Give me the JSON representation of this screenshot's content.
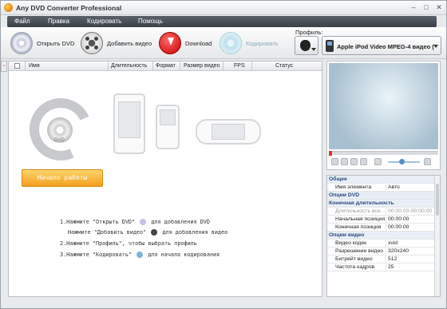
{
  "window": {
    "title": "Any DVD Converter Professional"
  },
  "menu": [
    {
      "label": "Файл"
    },
    {
      "label": "Правка"
    },
    {
      "label": "Кодировать"
    },
    {
      "label": "Помощь"
    }
  ],
  "toolbar": {
    "open_dvd": "Открыть DVD",
    "add_video": "Добавить видео",
    "download": "Download",
    "encode": "Кодировать"
  },
  "profile": {
    "label": "Профиль:",
    "value": "Apple iPod Video MPEG-4 видео (*.m..."
  },
  "table": {
    "columns": [
      "Имя",
      "Длительность",
      "Формат",
      "Размер видео",
      "FPS",
      "Статус"
    ]
  },
  "empty": {
    "dvd_text": "DVD",
    "start_button": "Начало работы",
    "hints": [
      "1.Нажмите \"Открыть DVD\"",
      "для добавления DVD",
      "Нажмите \"Добавить видео\"",
      "для добавления видео",
      "2.Нажмите \"Профиль\", чтобы выбрать профиль",
      "3.Нажмите \"Кодировать\"",
      "для начала кодирования"
    ]
  },
  "properties": {
    "general_header": "Общее",
    "item_name_key": "Имя элемента",
    "item_name_val": "Авто",
    "dvd_options_header": "Опции DVD",
    "end_duration_header": "Конечная длительность",
    "duration_all_key": "Длительность все...",
    "duration_all_val": "00:00:00-00:00:00",
    "start_pos_key": "Начальная позиция",
    "start_pos_val": "00:00:00",
    "end_pos_key": "Конечная позиция",
    "end_pos_val": "00:00:00",
    "video_options_header": "Опции видео",
    "codec_key": "Видео кодек",
    "codec_val": "xvid",
    "res_key": "Разрешение видео",
    "res_val": "320x240",
    "bitrate_key": "Битрейт видео",
    "bitrate_val": "512",
    "fps_key": "Частота кадров",
    "fps_val": "25"
  },
  "colors": {
    "accent": "#f2a01e",
    "menubar": "#4a5058",
    "group_header": "#2a4a7a"
  }
}
